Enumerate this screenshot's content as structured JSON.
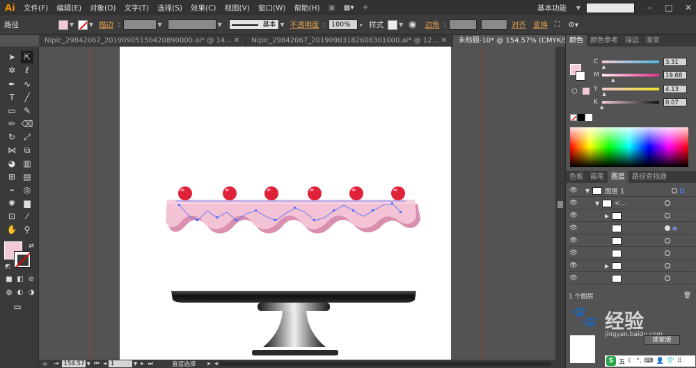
{
  "app": {
    "logo": "Ai"
  },
  "menu": [
    "文件(F)",
    "编辑(E)",
    "对象(O)",
    "文字(T)",
    "选择(S)",
    "效果(C)",
    "视图(V)",
    "窗口(W)",
    "帮助(H)"
  ],
  "workspace": "基本功能",
  "control": {
    "object_type": "路径",
    "stroke_label": "描边",
    "brush_label": "基本",
    "opacity_label": "不透明度",
    "opacity_value": "100%",
    "style_label": "样式",
    "corner_label": "边角",
    "align_label": "对齐",
    "transform_label": "变换"
  },
  "tabs": [
    {
      "label": "Nipic_29842067_20190905150420890000.ai* @ 14..."
    },
    {
      "label": "Nipic_29842067_20190903182608301000.ai* @ 12..."
    },
    {
      "label": "未标题-10* @ 154.57% (CMYK/预览)"
    }
  ],
  "color_panel": {
    "tabs": [
      "颜色",
      "颜色参考",
      "描边",
      "渐变"
    ],
    "sliders": [
      {
        "label": "C",
        "value": "3.31",
        "pct": 3.31
      },
      {
        "label": "M",
        "value": "19.68",
        "pct": 19.68
      },
      {
        "label": "Y",
        "value": "4.13",
        "pct": 4.13
      },
      {
        "label": "K",
        "value": "0.07",
        "pct": 0.07
      }
    ]
  },
  "layers_panel": {
    "tabs": [
      "色板",
      "画笔",
      "图层",
      "路径查找器"
    ],
    "layer_name": "图层 1",
    "sublayer_name": "<...",
    "footer": "1 个图层"
  },
  "status": {
    "zoom": "154.57",
    "page": "1",
    "tool": "直接选择"
  },
  "colors": {
    "fill": "#f3c9d5",
    "cake_icing": "#f4c2d5",
    "cake_shadow": "#d88fb0",
    "cherry": "#e0213a"
  },
  "watermark": {
    "text": "经验",
    "domain": "jingyan.baidu.com",
    "button": "建蒙版"
  },
  "ime": {
    "label": "五"
  }
}
